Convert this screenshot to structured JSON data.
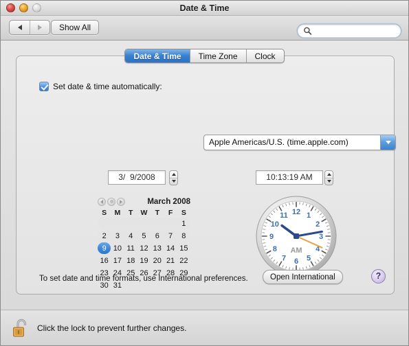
{
  "window": {
    "title": "Date & Time",
    "traffic": {
      "close": "close-button",
      "minimize": "minimize-button",
      "zoom": "zoom-button"
    }
  },
  "toolbar": {
    "back_label": "Back",
    "forward_label": "Forward",
    "show_all_label": "Show All",
    "search": {
      "value": "",
      "placeholder": ""
    }
  },
  "tabs": [
    {
      "label": "Date & Time",
      "active": true
    },
    {
      "label": "Time Zone",
      "active": false
    },
    {
      "label": "Clock",
      "active": false
    }
  ],
  "auto": {
    "checkbox_checked": true,
    "label": "Set date & time automatically:",
    "server_value": "Apple Americas/U.S. (time.apple.com)"
  },
  "date_field": {
    "value": "3/  9/2008"
  },
  "time_field": {
    "value": "10:13:19 AM"
  },
  "calendar": {
    "title": "March 2008",
    "daynames": [
      "S",
      "M",
      "T",
      "W",
      "T",
      "F",
      "S"
    ],
    "selected_day": 9,
    "weeks": [
      [
        "",
        "",
        "",
        "",
        "",
        "",
        "1"
      ],
      [
        "2",
        "3",
        "4",
        "5",
        "6",
        "7",
        "8"
      ],
      [
        "9",
        "10",
        "11",
        "12",
        "13",
        "14",
        "15"
      ],
      [
        "16",
        "17",
        "18",
        "19",
        "20",
        "21",
        "22"
      ],
      [
        "23",
        "24",
        "25",
        "26",
        "27",
        "28",
        "29"
      ],
      [
        "30",
        "31",
        "",
        "",
        "",
        "",
        ""
      ]
    ]
  },
  "clock": {
    "meridiem": "AM",
    "hours": 10,
    "minutes": 13,
    "seconds": 19,
    "numerals": [
      "12",
      "1",
      "2",
      "3",
      "4",
      "5",
      "6",
      "7",
      "8",
      "9",
      "10",
      "11"
    ],
    "face_color": "#ffffff",
    "numeral_color": "#3a6fb0",
    "hand_color": "#2b4a8c",
    "second_hand_color": "#e8a33d"
  },
  "footer": {
    "note": "To set date and time formats, use International preferences.",
    "open_international_label": "Open International",
    "help_label": "?"
  },
  "lockbar": {
    "text": "Click the lock to prevent further changes.",
    "state": "unlocked"
  }
}
